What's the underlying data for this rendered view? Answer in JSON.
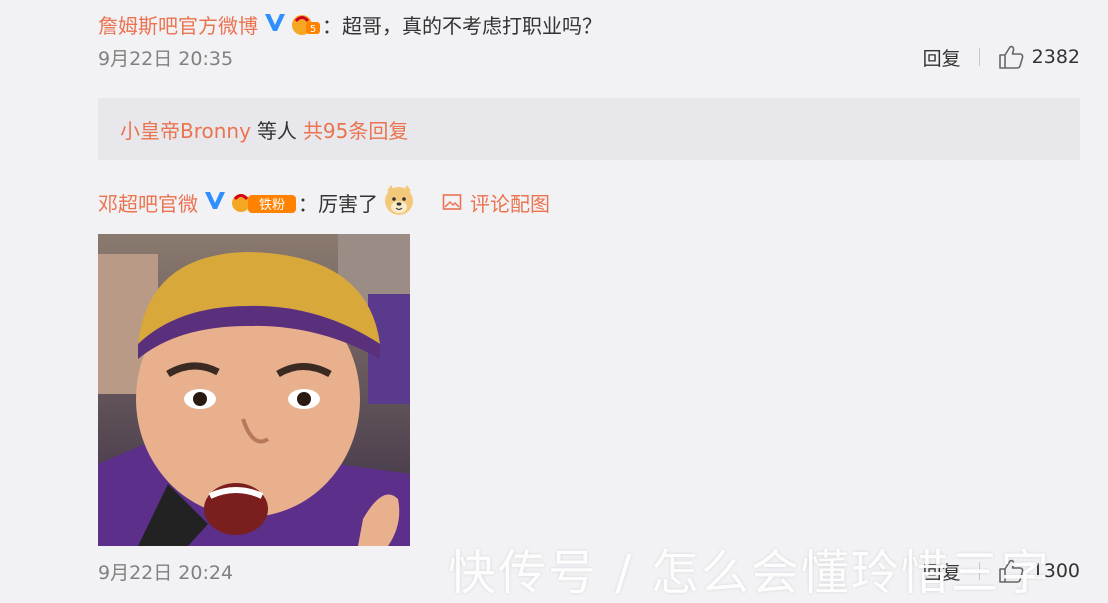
{
  "comment1": {
    "user": "詹姆斯吧官方微博",
    "text": "：超哥，真的不考虑打职业吗？",
    "date": "9月22日 20:35",
    "reply_label": "回复",
    "likes": "2382"
  },
  "replies": {
    "user": "小皇帝Bronny",
    "middle": "等人",
    "count": "共95条回复"
  },
  "comment2": {
    "user": "邓超吧官微",
    "badge_text": "铁粉",
    "text": "：厉害了",
    "pic_link": "评论配图",
    "date": "9月22日 20:24",
    "reply_label": "回复",
    "likes": "1300"
  },
  "watermark": "快传号 / 怎么会懂玲惜三字",
  "colors": {
    "accent": "#eb7350",
    "verified": "#2f8fff",
    "background": "#f2f2f5"
  }
}
